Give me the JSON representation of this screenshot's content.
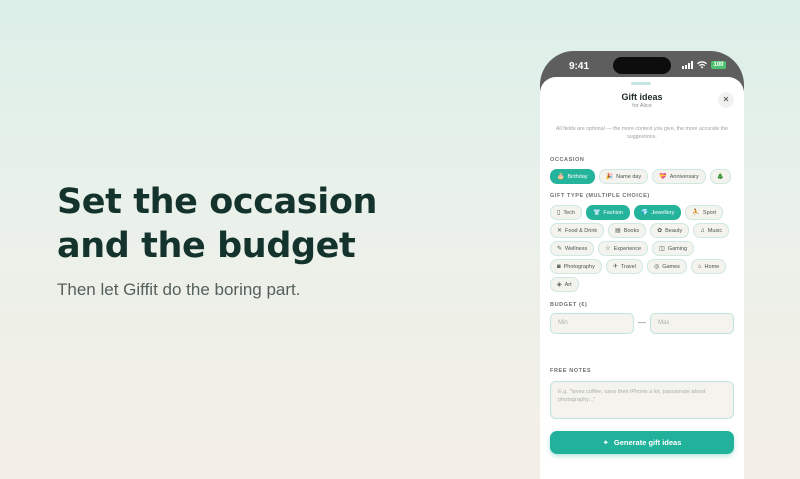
{
  "hero": {
    "headline_line1": "Set the occasion",
    "headline_line2": "and the budget",
    "subtitle": "Then let Giffit do the boring part."
  },
  "status_bar": {
    "time": "9:41",
    "battery": "100"
  },
  "sheet": {
    "title": "Gift ideas",
    "subtitle": "for Alice",
    "close_label": "✕",
    "intro": "All fields are optional — the more context you give, the more accurate the suggestions."
  },
  "occasion": {
    "label": "OCCASION",
    "chips": [
      {
        "label": "Birthday",
        "icon": "🎂",
        "selected": true
      },
      {
        "label": "Name day",
        "icon": "🎉",
        "selected": false
      },
      {
        "label": "Anniversary",
        "icon": "💝",
        "selected": false
      },
      {
        "label": "",
        "icon": "🎄",
        "selected": false
      }
    ]
  },
  "gift_type": {
    "label": "GIFT TYPE (MULTIPLE CHOICE)",
    "rows": [
      [
        {
          "label": "Tech",
          "icon": "▯",
          "selected": false
        },
        {
          "label": "Fashion",
          "icon": "👕",
          "selected": true
        },
        {
          "label": "Jewellery",
          "icon": "💎",
          "selected": true
        },
        {
          "label": "Sport",
          "icon": "⛹",
          "selected": false
        }
      ],
      [
        {
          "label": "Food & Drink",
          "icon": "✕",
          "selected": false
        },
        {
          "label": "Books",
          "icon": "▤",
          "selected": false
        },
        {
          "label": "Beauty",
          "icon": "✿",
          "selected": false
        },
        {
          "label": "Music",
          "icon": "♫",
          "selected": false
        }
      ],
      [
        {
          "label": "Wellness",
          "icon": "✎",
          "selected": false
        },
        {
          "label": "Experience",
          "icon": "☆",
          "selected": false
        },
        {
          "label": "Gaming",
          "icon": "◫",
          "selected": false
        }
      ],
      [
        {
          "label": "Photography",
          "icon": "◙",
          "selected": false
        },
        {
          "label": "Travel",
          "icon": "✈",
          "selected": false
        },
        {
          "label": "Games",
          "icon": "◎",
          "selected": false
        },
        {
          "label": "Home",
          "icon": "⌂",
          "selected": false
        }
      ],
      [
        {
          "label": "Art",
          "icon": "◈",
          "selected": false
        }
      ]
    ]
  },
  "budget": {
    "label": "BUDGET (€)",
    "min_placeholder": "Min",
    "max_placeholder": "Max",
    "separator": "—"
  },
  "notes": {
    "label": "FREE NOTES",
    "placeholder": "E.g. \"loves coffee, uses their iPhone a lot, passionate about photography...\""
  },
  "cta": {
    "label": "Generate gift ideas",
    "icon": "✦"
  },
  "colors": {
    "accent": "#24b39b",
    "headline": "#13332c"
  }
}
